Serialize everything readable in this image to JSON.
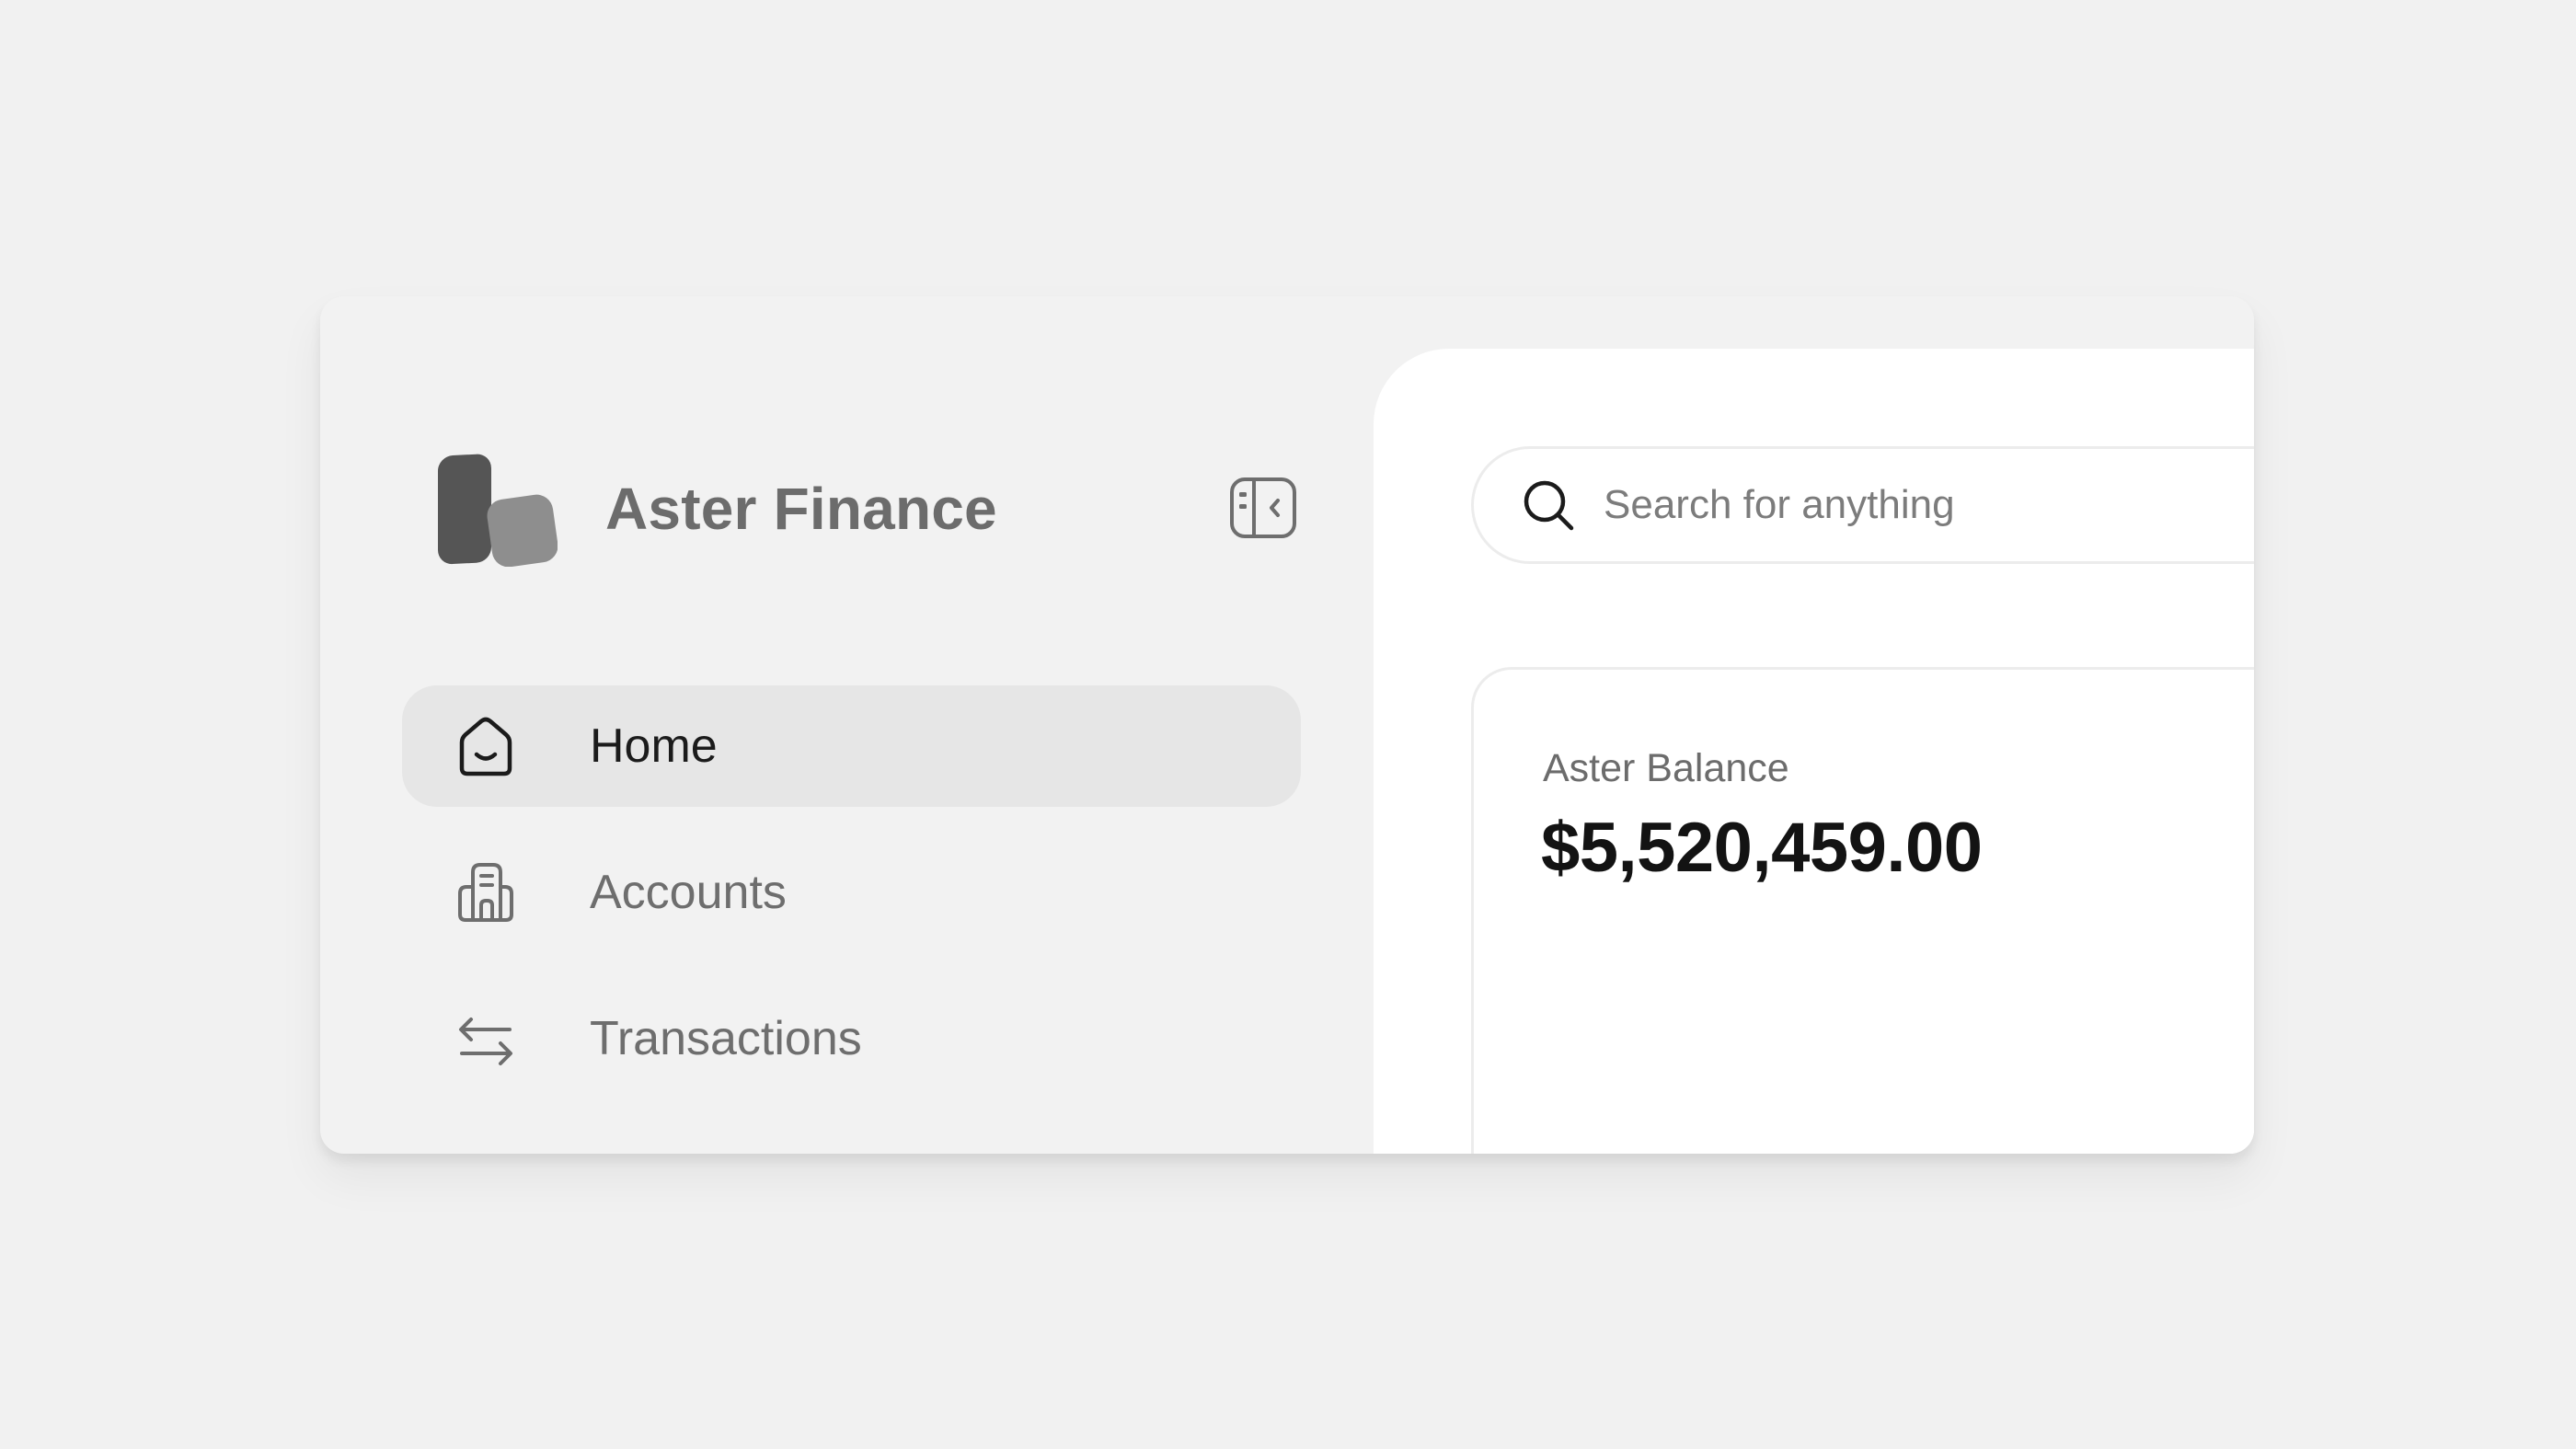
{
  "app": {
    "name": "Aster Finance"
  },
  "sidebar": {
    "items": [
      {
        "label": "Home",
        "icon": "home-icon",
        "active": true
      },
      {
        "label": "Accounts",
        "icon": "building-icon",
        "active": false
      },
      {
        "label": "Transactions",
        "icon": "transfer-arrows-icon",
        "active": false
      }
    ]
  },
  "search": {
    "placeholder": "Search for anything",
    "value": ""
  },
  "balance": {
    "label": "Aster Balance",
    "amount": "$5,520,459.00"
  },
  "colors": {
    "page_background": "#f1f1f1",
    "sidebar_background": "#f2f2f2",
    "active_item_background": "#e6e6e6",
    "main_background": "#ffffff",
    "logo_dark": "#555555",
    "logo_light": "#8e8e8e"
  }
}
